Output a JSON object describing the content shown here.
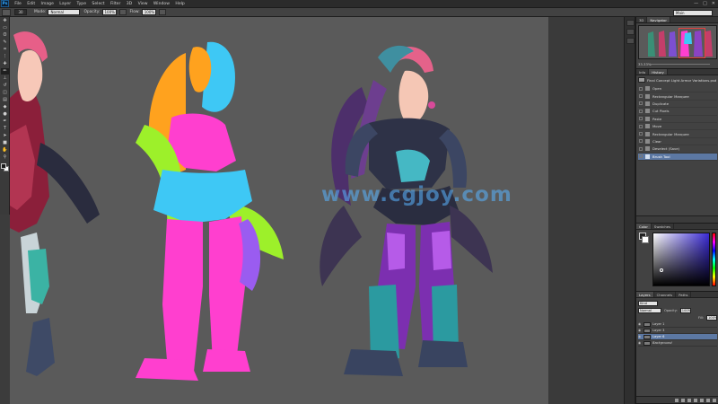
{
  "app": {
    "logo": "Ps"
  },
  "menubar": {
    "items": [
      "File",
      "Edit",
      "Image",
      "Layer",
      "Type",
      "Select",
      "Filter",
      "3D",
      "View",
      "Window",
      "Help"
    ],
    "window_controls": [
      "—",
      "□",
      "✕"
    ]
  },
  "options_bar": {
    "brush_size": "30",
    "mode_label": "Mode:",
    "mode_value": "Normal",
    "opacity_label": "Opacity:",
    "opacity_value": "100%",
    "flow_label": "Flow:",
    "flow_value": "100%",
    "workspace": "Main"
  },
  "toolbar": {
    "tools": [
      {
        "name": "move-tool",
        "glyph": "✥"
      },
      {
        "name": "marquee-tool",
        "glyph": "▭"
      },
      {
        "name": "lasso-tool",
        "glyph": "ʘ"
      },
      {
        "name": "quick-select-tool",
        "glyph": "✎"
      },
      {
        "name": "crop-tool",
        "glyph": "⌗"
      },
      {
        "name": "eyedropper-tool",
        "glyph": "ᛙ"
      },
      {
        "name": "healing-brush-tool",
        "glyph": "✚"
      },
      {
        "name": "brush-tool",
        "glyph": "✏"
      },
      {
        "name": "clone-stamp-tool",
        "glyph": "⊥"
      },
      {
        "name": "history-brush-tool",
        "glyph": "↺"
      },
      {
        "name": "eraser-tool",
        "glyph": "◫"
      },
      {
        "name": "gradient-tool",
        "glyph": "▤"
      },
      {
        "name": "blur-tool",
        "glyph": "◆"
      },
      {
        "name": "dodge-tool",
        "glyph": "●"
      },
      {
        "name": "pen-tool",
        "glyph": "✒"
      },
      {
        "name": "type-tool",
        "glyph": "T"
      },
      {
        "name": "path-select-tool",
        "glyph": "➤"
      },
      {
        "name": "shape-tool",
        "glyph": "■"
      },
      {
        "name": "hand-tool",
        "glyph": "✋"
      },
      {
        "name": "zoom-tool",
        "glyph": "⚲"
      }
    ],
    "active_tool": "brush-tool"
  },
  "navigator": {
    "tabs": [
      "3D",
      "Navigator"
    ],
    "active_tab": "Navigator",
    "zoom": "33.33%"
  },
  "history": {
    "tabs": [
      "Info",
      "History"
    ],
    "active_tab": "History",
    "snapshot": "Final Concept Light Armor Variations.psd",
    "states": [
      {
        "label": "Open",
        "current": false
      },
      {
        "label": "Rectangular Marquee",
        "current": false
      },
      {
        "label": "Duplicate",
        "current": false
      },
      {
        "label": "Cut Pixels",
        "current": false
      },
      {
        "label": "Paste",
        "current": false
      },
      {
        "label": "Move",
        "current": false
      },
      {
        "label": "Rectangular Marquee",
        "current": false
      },
      {
        "label": "Clear",
        "current": false
      },
      {
        "label": "Deselect (Save)",
        "current": false
      },
      {
        "label": "Brush Tool",
        "current": true
      }
    ]
  },
  "color_panel": {
    "tabs": [
      "Color",
      "Swatches"
    ],
    "active_tab": "Color",
    "hue_color": "#3b2bd6"
  },
  "layers": {
    "tabs": [
      "Layers",
      "Channels",
      "Paths"
    ],
    "active_tab": "Layers",
    "kind_label": "Kind",
    "blend_mode": "Normal",
    "opacity_label": "Opacity:",
    "opacity_value": "100%",
    "fill_label": "Fill:",
    "fill_value": "100%",
    "items": [
      {
        "name": "Layer 1",
        "selected": false,
        "background": false
      },
      {
        "name": "Layer 3",
        "selected": false,
        "background": false
      },
      {
        "name": "Layer 6",
        "selected": true,
        "background": false
      },
      {
        "name": "Background",
        "selected": false,
        "background": true
      }
    ]
  },
  "canvas": {
    "watermark": "www.cgjoy.com",
    "flat_colors": {
      "orange": "#ffa21e",
      "cyan": "#3ec8f5",
      "magenta": "#ff3fcf",
      "lime": "#9df02a",
      "violet": "#9a5cf0"
    }
  }
}
